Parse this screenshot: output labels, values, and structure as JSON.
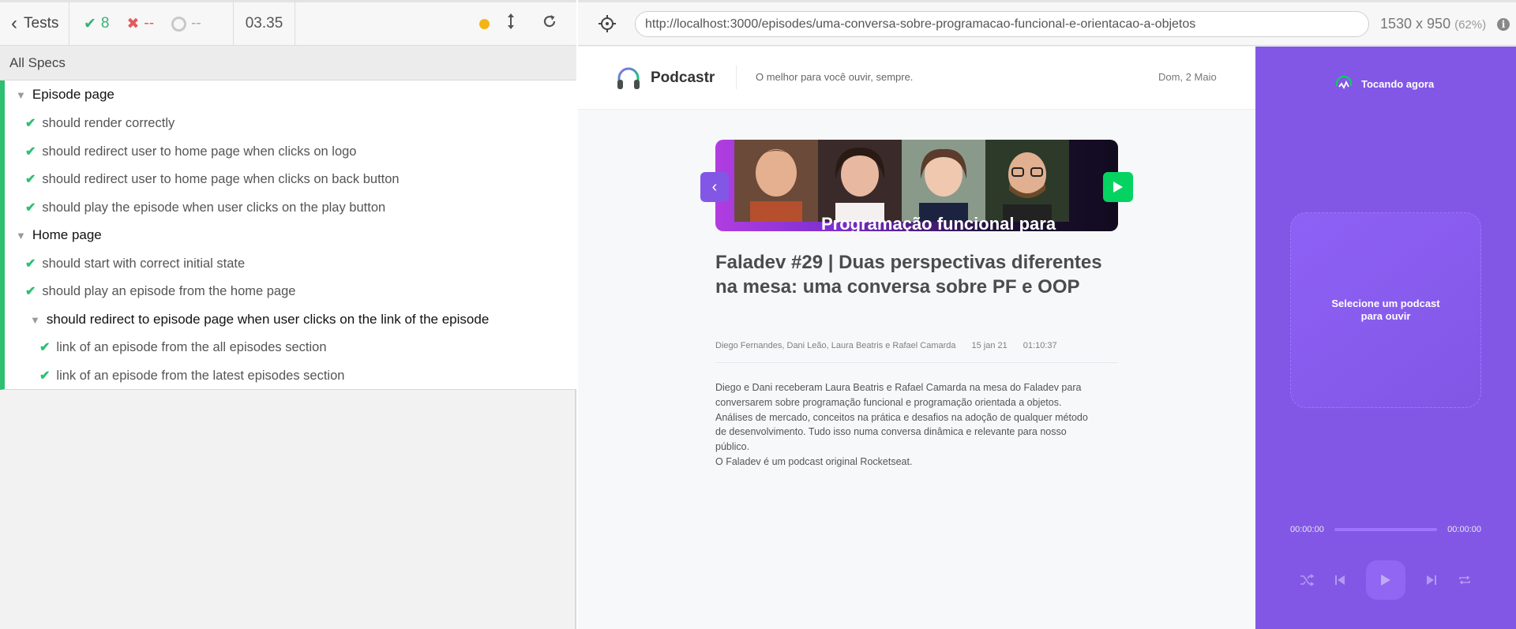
{
  "reporter": {
    "tests_label": "Tests",
    "passed": "8",
    "failed": "--",
    "pending": "--",
    "duration": "03.35",
    "all_specs": "All Specs",
    "rows": [
      {
        "kind": "suite",
        "label": "Episode page"
      },
      {
        "kind": "test",
        "label": "should render correctly"
      },
      {
        "kind": "test",
        "label": "should redirect user to home page when clicks on logo"
      },
      {
        "kind": "test",
        "label": "should redirect user to home page when clicks on back button"
      },
      {
        "kind": "test",
        "label": "should play the episode when user clicks on the play button"
      },
      {
        "kind": "suite",
        "label": "Home page"
      },
      {
        "kind": "test",
        "label": "should start with correct initial state"
      },
      {
        "kind": "test",
        "label": "should play an episode from the home page"
      },
      {
        "kind": "suite",
        "label": "should redirect to episode page when user clicks on the link of the episode"
      },
      {
        "kind": "test",
        "label": "link of an episode from the all episodes section"
      },
      {
        "kind": "test",
        "label": "link of an episode from the latest episodes section"
      }
    ]
  },
  "browser": {
    "url": "http://localhost:3000/episodes/uma-conversa-sobre-programacao-funcional-e-orientacao-a-objetos",
    "viewport": "1530 x 950",
    "scale": "(62%)"
  },
  "app": {
    "logo_text": "Podcastr",
    "tagline": "O melhor para você ouvir, sempre.",
    "date": "Dom, 2 Maio",
    "thumbnail_text": "Programação funcional para",
    "episode": {
      "title": "Faladev #29 | Duas perspectivas diferentes na mesa: uma conversa sobre PF e OOP",
      "members": "Diego Fernandes, Dani Leão, Laura Beatris e Rafael Camarda",
      "published_at": "15 jan 21",
      "duration": "01:10:37",
      "description_lines": [
        "Diego e Dani receberam Laura Beatris e Rafael Camarda na mesa do Faladev para",
        "conversarem sobre programação funcional e programação orientada a objetos.",
        "Análises de mercado, conceitos na prática e desafios na adoção de qualquer método",
        "de desenvolvimento. Tudo isso numa conversa dinâmica e relevante para nosso",
        "público.",
        "O Faladev é um podcast original Rocketseat."
      ]
    },
    "player": {
      "header": "Tocando agora",
      "empty_message": "Selecione um podcast para ouvir",
      "current_time": "00:00:00",
      "total_time": "00:00:00"
    }
  },
  "colors": {
    "passed": "#2fbf71",
    "failed": "#e45a5a",
    "purple": "#8257e5",
    "green": "#04d361"
  }
}
